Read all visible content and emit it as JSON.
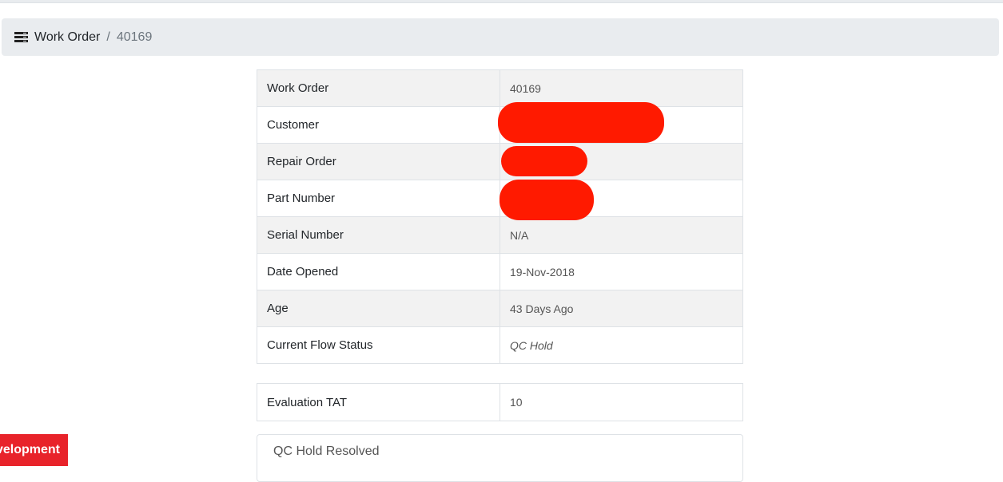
{
  "breadcrumb": {
    "icon": "list-icon",
    "root_label": "Work Order",
    "separator": "/",
    "current": "40169"
  },
  "details": [
    {
      "label": "Work Order",
      "value": "40169",
      "italic": false,
      "redacted": false
    },
    {
      "label": "Customer",
      "value": "",
      "italic": false,
      "redacted": true
    },
    {
      "label": "Repair Order",
      "value": "",
      "italic": false,
      "redacted": true
    },
    {
      "label": "Part Number",
      "value": "",
      "italic": false,
      "redacted": true
    },
    {
      "label": "Serial Number",
      "value": "N/A",
      "italic": false,
      "redacted": false
    },
    {
      "label": "Date Opened",
      "value": "19-Nov-2018",
      "italic": false,
      "redacted": false
    },
    {
      "label": "Age",
      "value": "43 Days Ago",
      "italic": false,
      "redacted": false
    },
    {
      "label": "Current Flow Status",
      "value": "QC Hold",
      "italic": true,
      "redacted": false
    }
  ],
  "tat": {
    "label": "Evaluation TAT",
    "value": "10"
  },
  "card": {
    "title": "QC Hold Resolved"
  },
  "environment_badge": {
    "text": "velopment",
    "color": "#e8232a"
  },
  "colors": {
    "redaction": "#ff1a00",
    "breadcrumb_bg": "#e9ecef",
    "striped_row": "#f2f2f2"
  }
}
